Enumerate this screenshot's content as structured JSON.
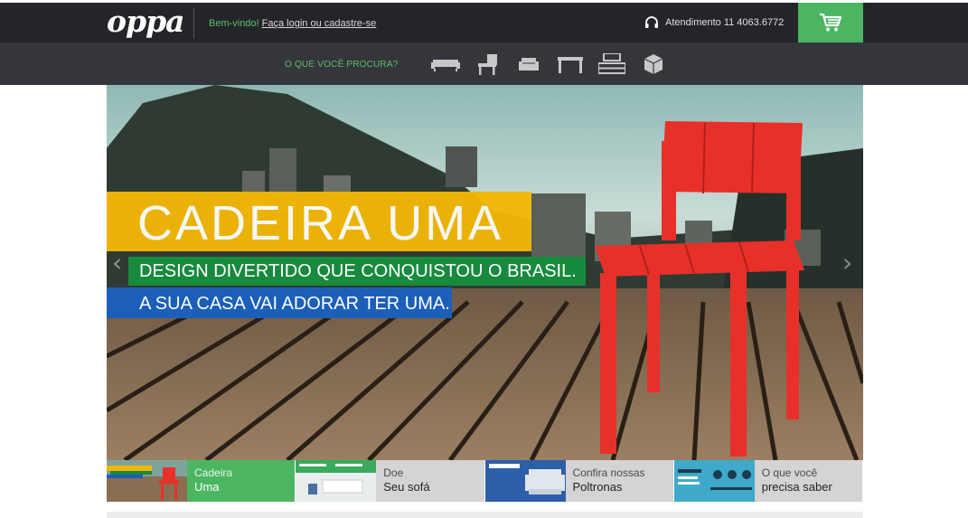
{
  "header": {
    "logo": "oppa",
    "welcome_text": "Bem-vindo!",
    "login_link": "Faça login ou cadastre-se",
    "support_text": "Atendimento 11 4063.6772",
    "support_icon": "headset-icon",
    "cart_icon": "cart-icon"
  },
  "nav": {
    "label": "O QUE VOCÊ PROCURA?",
    "categories": [
      {
        "icon": "sofa-icon"
      },
      {
        "icon": "chair-icon"
      },
      {
        "icon": "armchair-icon"
      },
      {
        "icon": "table-icon"
      },
      {
        "icon": "shelf-icon"
      },
      {
        "icon": "box-icon"
      }
    ]
  },
  "hero": {
    "title": "CADEIRA UMA",
    "line1": "DESIGN DIVERTIDO QUE CONQUISTOU O BRASIL.",
    "line2": "A SUA CASA VAI ADORAR TER UMA.",
    "prev_arrow": "‹",
    "next_arrow": "›"
  },
  "thumbs": [
    {
      "line1": "Cadeira",
      "line2": "Uma",
      "active": true
    },
    {
      "line1": "Doe",
      "line2": "Seu sofá",
      "active": false
    },
    {
      "line1": "Confira nossas",
      "line2": "Poltronas",
      "active": false
    },
    {
      "line1": "O que você",
      "line2": "precisa saber",
      "active": false
    }
  ],
  "colors": {
    "accent_green": "#4cb562",
    "topbar": "#24252b",
    "navbar": "#35363c",
    "banner_yellow": "#f2b705",
    "banner_green": "#178a3d",
    "banner_blue": "#1b5fb8",
    "chair_red": "#e8302a"
  }
}
